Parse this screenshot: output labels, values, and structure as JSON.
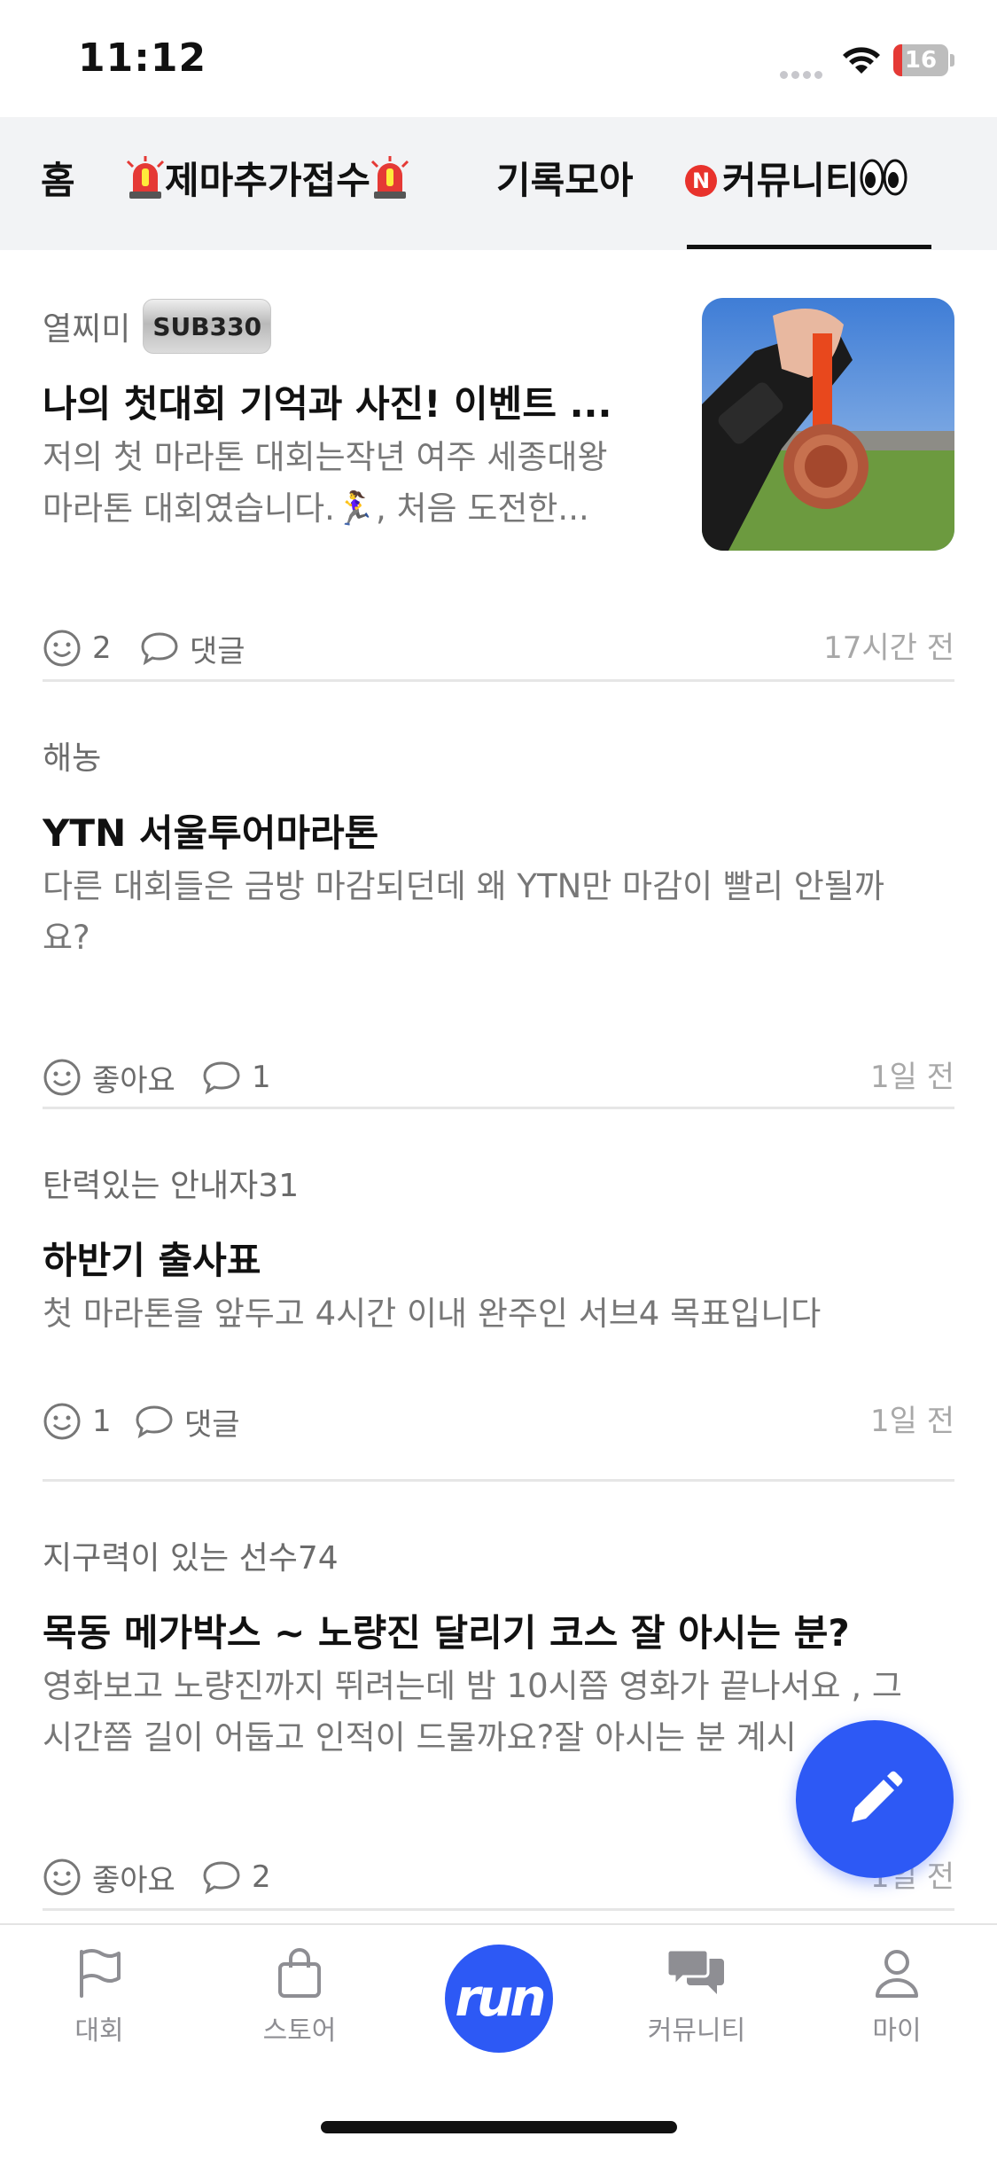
{
  "status_bar": {
    "time": "11:12",
    "battery": "16"
  },
  "tabs": [
    {
      "label": "홈"
    },
    {
      "label": "제마추가접수"
    },
    {
      "label": "기록모아"
    },
    {
      "label": "커뮤니티",
      "badge": "N"
    }
  ],
  "posts": [
    {
      "author": "열찌미",
      "badge": "SUB330",
      "title": "나의 첫대회 기억과 사진! 이벤트 ...",
      "body_lines": [
        "저의 첫 마라톤 대회는작년 여주 세종대왕",
        "마라톤 대회였습니다.🏃‍♀️, 처음 도전한..."
      ],
      "likes": "2",
      "comments": "댓글",
      "time": "17시간 전",
      "thumbnail": "medal-photo"
    },
    {
      "author": "해농",
      "title": "YTN 서울투어마라톤",
      "body_lines": [
        "다른 대회들은 금방 마감되던데 왜 YTN만 마감이 빨리 안될까",
        "요?"
      ],
      "likes": "좋아요",
      "comments": "1",
      "time": "1일 전"
    },
    {
      "author": "탄력있는 안내자31",
      "title": "하반기 출사표",
      "body_lines": [
        "첫 마라톤을 앞두고 4시간 이내 완주인 서브4 목표입니다"
      ],
      "likes": "1",
      "comments": "댓글",
      "time": "1일 전"
    },
    {
      "author": "지구력이 있는 선수74",
      "title": "목동 메가박스 ~ 노량진 달리기 코스 잘 아시는 분?",
      "body_lines": [
        "영화보고 노량진까지 뛰려는데 밤 10시쯤 영화가 끝나서요 , 그",
        "시간쯤 길이 어둡고 인적이 드물까요?잘 아시는 분 계시"
      ],
      "likes": "좋아요",
      "comments": "2",
      "time": "1일 전"
    }
  ],
  "bottom_nav": [
    {
      "label": "대회",
      "icon": "flag-icon"
    },
    {
      "label": "스토어",
      "icon": "bag-icon"
    },
    {
      "label": "run",
      "icon": "run-logo"
    },
    {
      "label": "커뮤니티",
      "icon": "chat-bubbles-icon"
    },
    {
      "label": "마이",
      "icon": "person-icon"
    }
  ],
  "fab": {
    "icon": "pencil-icon"
  },
  "colors": {
    "accent": "#2d59f5",
    "tab_bg": "#f2f3f5",
    "badge_red": "#e8322c"
  }
}
